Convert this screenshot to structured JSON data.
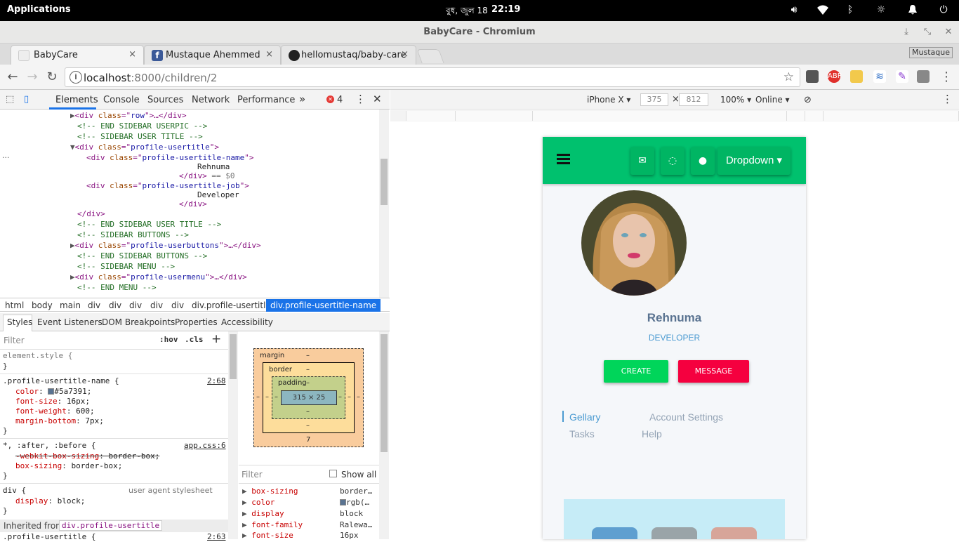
{
  "system": {
    "apps": "Applications",
    "date": "বুধ, জুল 18",
    "time": "22:19"
  },
  "window": {
    "title": "BabyCare - Chromium"
  },
  "tabs": [
    {
      "label": "BabyCare",
      "close": "×"
    },
    {
      "label": "Mustaque Ahemmed",
      "close": "×"
    },
    {
      "label": "hellomustaq/baby-care",
      "close": "×"
    }
  ],
  "profile_chip": "Mustaque",
  "address": {
    "host": "localhost",
    "rest": ":8000/children/2"
  },
  "devtools": {
    "tabs": [
      "Elements",
      "Console",
      "Sources",
      "Network",
      "Performance"
    ],
    "more": "»",
    "errors": "4",
    "dom_lines": [
      {
        "i": 8,
        "arrow": "▶",
        "html": "<div class=\"row\">…</div>"
      },
      {
        "i": 9,
        "arrow": "",
        "html": "<!-- END SIDEBAR USERPIC -->"
      },
      {
        "i": 9,
        "arrow": "",
        "html": "<!-- SIDEBAR USER TITLE -->"
      },
      {
        "i": 8,
        "arrow": "▼",
        "html": "<div class=\"profile-usertitle\">"
      },
      {
        "i": 10,
        "arrow": "",
        "html": "<div class=\"profile-usertitle-name\">"
      },
      {
        "i": 0,
        "arrow": "",
        "html": "Rehnuma"
      },
      {
        "i": 0,
        "arrow": "",
        "html": "</div> == $0"
      },
      {
        "i": 10,
        "arrow": "",
        "html": "<div class=\"profile-usertitle-job\">"
      },
      {
        "i": 0,
        "arrow": "",
        "html": "Developer"
      },
      {
        "i": 0,
        "arrow": "",
        "html": "</div>"
      },
      {
        "i": 9,
        "arrow": "",
        "html": "</div>"
      },
      {
        "i": 9,
        "arrow": "",
        "html": "<!-- END SIDEBAR USER TITLE -->"
      },
      {
        "i": 9,
        "arrow": "",
        "html": "<!-- SIDEBAR BUTTONS -->"
      },
      {
        "i": 8,
        "arrow": "▶",
        "html": "<div class=\"profile-userbuttons\">…</div>"
      },
      {
        "i": 9,
        "arrow": "",
        "html": "<!-- END SIDEBAR BUTTONS -->"
      },
      {
        "i": 9,
        "arrow": "",
        "html": "<!-- SIDEBAR MENU -->"
      },
      {
        "i": 8,
        "arrow": "▶",
        "html": "<div class=\"profile-usermenu\">…</div>"
      },
      {
        "i": 9,
        "arrow": "",
        "html": "<!-- END MENU -->"
      }
    ],
    "breadcrumbs": [
      "html",
      "body",
      "main",
      "div",
      "div",
      "div",
      "div",
      "div",
      "div.profile-usertitle"
    ],
    "breadcrumb_active": "div.profile-usertitle-name",
    "subtabs": [
      "Styles",
      "Event Listeners",
      "DOM Breakpoints",
      "Properties",
      "Accessibility"
    ],
    "filter": "Filter",
    "hov": ":hov",
    "cls": ".cls",
    "styles": {
      "element_style": "element.style {",
      "close": "}",
      "rule1_sel": ".profile-usertitle-name {",
      "rule1_src": "2:68",
      "rule1_props": [
        {
          "p": "color",
          "v": "#5a7391;"
        },
        {
          "p": "font-size",
          "v": "16px;"
        },
        {
          "p": "font-weight",
          "v": "600;"
        },
        {
          "p": "margin-bottom",
          "v": "7px;"
        }
      ],
      "rule2_sel": "*, :after, :before {",
      "rule2_src": "app.css:6",
      "rule2_props": [
        {
          "p": "-webkit-box-sizing",
          "v": "border-box;"
        },
        {
          "p": "box-sizing",
          "v": "border-box;"
        }
      ],
      "rule3_sel": "div {",
      "rule3_src": "user agent stylesheet",
      "rule3_prop": {
        "p": "display",
        "v": "block;"
      },
      "inherited": "Inherited from",
      "inherited_from": "div.profile-usertitle",
      "rule4_sel": ".profile-usertitle {",
      "rule4_src": "2:63"
    },
    "boxmodel": {
      "margin": "margin",
      "border": "border",
      "padding": "padding",
      "dash": "–",
      "content": "315 × 25",
      "bottom": "7"
    },
    "computed": {
      "filter": "Filter",
      "show_all": "Show all",
      "rows": [
        {
          "p": "box-sizing",
          "v": "border…"
        },
        {
          "p": "color",
          "v": "rgb(…"
        },
        {
          "p": "display",
          "v": "block"
        },
        {
          "p": "font-family",
          "v": "Ralewa…"
        },
        {
          "p": "font-size",
          "v": "16px"
        }
      ]
    }
  },
  "device": {
    "name": "iPhone X",
    "width": "375",
    "height": "812",
    "zoom": "100%",
    "net": "Online",
    "x": "×"
  },
  "page": {
    "dropdown": "Dropdown",
    "name": "Rehnuma",
    "job": "DEVELOPER",
    "create": "CREATE",
    "message": "MESSAGE",
    "menu": [
      "Gellary",
      "Account Settings",
      "Tasks",
      "Help"
    ]
  },
  "colors": {
    "nav": "#00c16e",
    "create": "#00d55a",
    "message": "#f5003f",
    "name": "#5a7391",
    "job": "#4a9ad1"
  }
}
